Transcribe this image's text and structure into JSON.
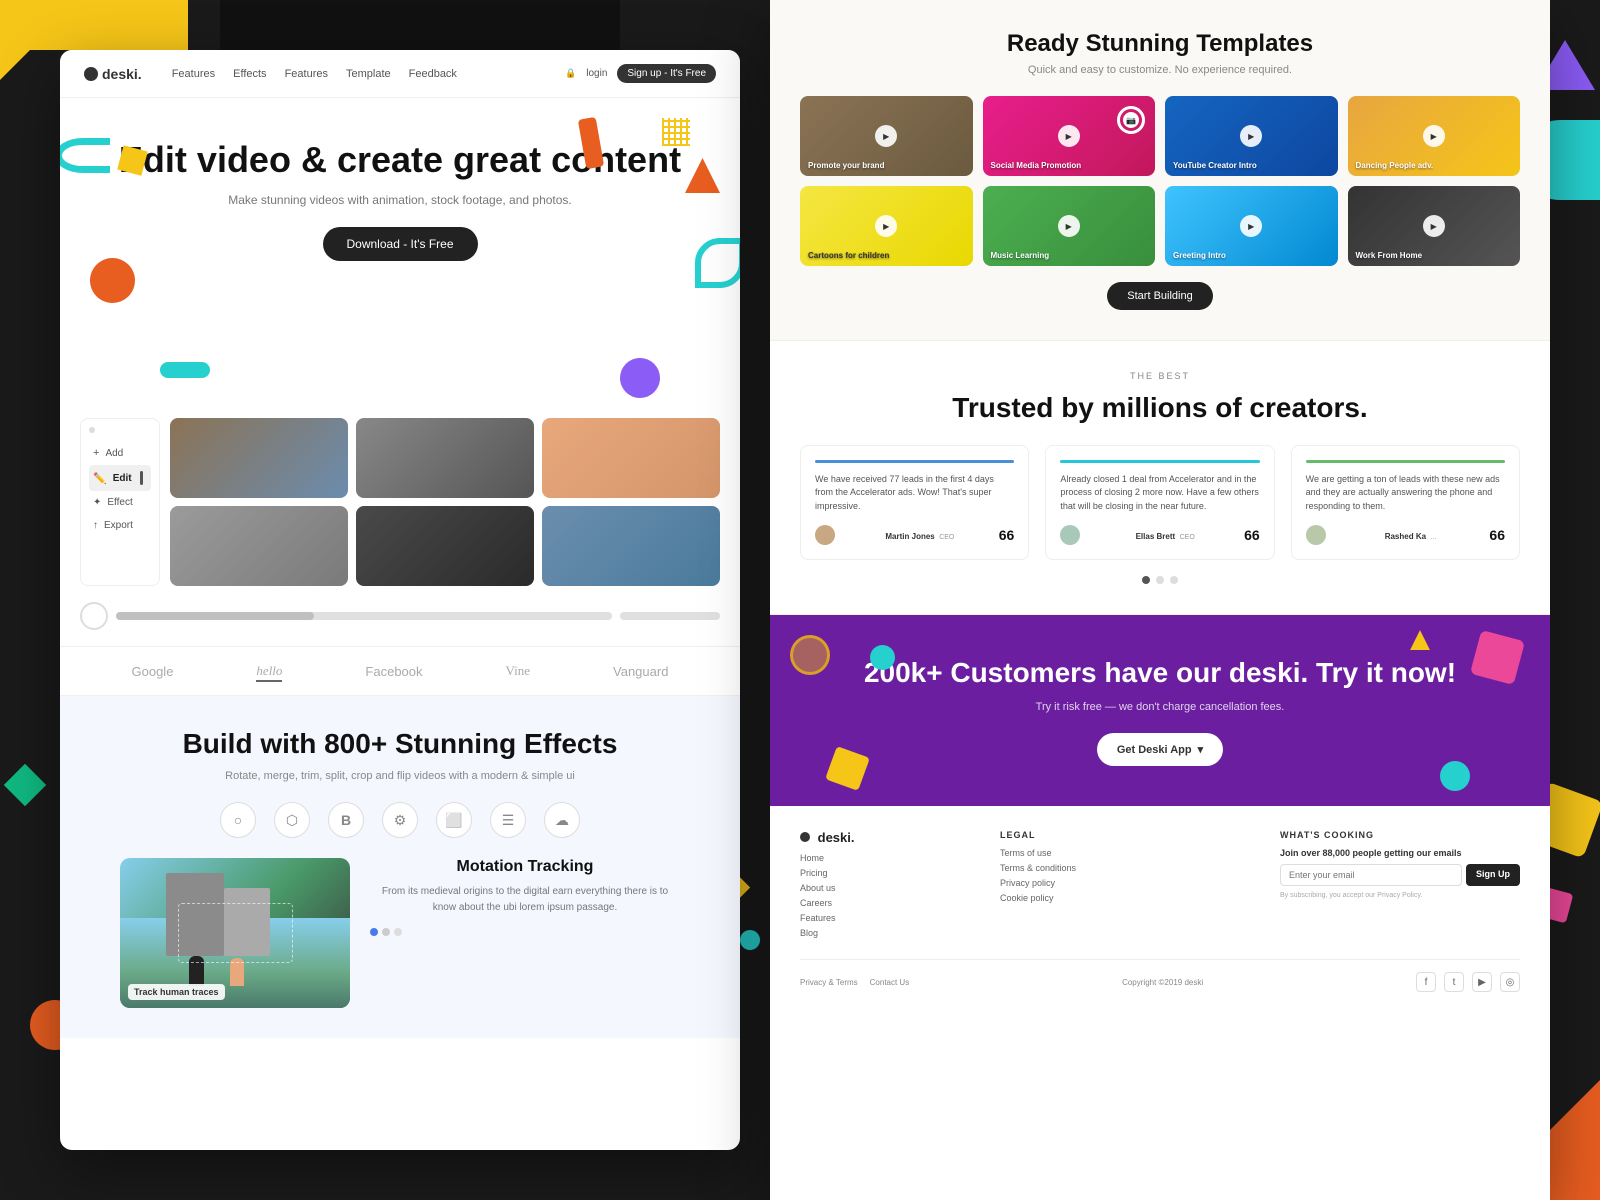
{
  "background": {
    "color": "#1a1a1a"
  },
  "left_panel": {
    "nav": {
      "logo": "deski.",
      "links": [
        "Features",
        "Effects",
        "Features",
        "Template",
        "Feedback"
      ],
      "login": "login",
      "signup": "Sign up - It's Free"
    },
    "hero": {
      "title": "Edit video & create great content",
      "subtitle": "Make stunning videos with animation, stock footage, and photos.",
      "cta_button": "Download - It's Free"
    },
    "editor": {
      "sidebar_items": [
        {
          "label": "Add",
          "active": false
        },
        {
          "label": "Edit",
          "active": true
        },
        {
          "label": "Effect",
          "active": false
        },
        {
          "label": "Export",
          "active": false
        }
      ]
    },
    "brands": [
      "Google",
      "hello",
      "Facebook",
      "Vine",
      "Vanguard"
    ],
    "effects": {
      "title": "Build with 800+ Stunning Effects",
      "subtitle": "Rotate, merge, trim, split, crop and flip videos with a modern & simple ui"
    },
    "motion": {
      "title": "Motation Tracking",
      "description": "From its medieval origins to the digital earn everything there is to know about the ubi lorem ipsum passage.",
      "image_label": "Track human traces"
    }
  },
  "right_panel": {
    "templates": {
      "title": "Ready Stunning Templates",
      "subtitle": "Quick and easy to customize. No experience required.",
      "button": "Start Building",
      "cards": [
        {
          "label": "Promote your brand",
          "color": "tc-1"
        },
        {
          "label": "Social Media Promotion",
          "color": "tc-2"
        },
        {
          "label": "YouTube Creator Intro",
          "color": "tc-3"
        },
        {
          "label": "Dancing People adv.",
          "color": "tc-4"
        },
        {
          "label": "Cartoons for children",
          "color": "tc-5"
        },
        {
          "label": "Music Learning",
          "color": "tc-6"
        },
        {
          "label": "Greeting Intro",
          "color": "tc-7"
        },
        {
          "label": "Work From Home",
          "color": "tc-8"
        }
      ]
    },
    "trusted": {
      "tag": "THE BEST",
      "title": "Trusted by millions of creators.",
      "testimonials": [
        {
          "text": "We have received 77 leads in the first 4 days from the Accelerator ads. Wow! That's super impressive.",
          "name": "Martin Jones",
          "name_suffix": "CEO",
          "score": "66",
          "bar_class": "test-bar-blue"
        },
        {
          "text": "Already closed 1 deal from Accelerator and in the process of closing 2 more now. Have a few others that will be closing in the near future.",
          "name": "Ellas Brett",
          "name_suffix": "CEO",
          "score": "66",
          "bar_class": "test-bar-teal"
        },
        {
          "text": "We are getting a ton of leads with these new ads and they are actually answering the phone and responding to them.",
          "name": "Rashed Ka",
          "name_suffix": "...",
          "score": "66",
          "bar_class": "test-bar-green"
        }
      ]
    },
    "cta": {
      "title": "200k+ Customers have our deski. Try it now!",
      "subtitle": "Try it risk free — we don't charge cancellation fees.",
      "button": "Get Deski App"
    },
    "footer": {
      "logo": "deski.",
      "info_links": [
        "Home",
        "Pricing",
        "About us",
        "Careers",
        "Features",
        "Blog"
      ],
      "legal_col_title": "Legal",
      "legal_links": [
        "Terms of use",
        "Terms & conditions",
        "Privacy policy",
        "Cookie policy"
      ],
      "newsletter_col_title": "What's Cooking",
      "newsletter_title": "Join over 88,000 people getting our emails",
      "newsletter_placeholder": "Enter your email",
      "newsletter_btn": "Sign Up",
      "newsletter_disclaimer": "By subscribing, you accept our Privacy Policy.",
      "bottom_links": [
        "Privacy & Terms",
        "Contact Us"
      ],
      "copyright": "Copyright ©2019 deski",
      "social_icons": [
        "fb",
        "tw",
        "yt",
        "ig"
      ]
    }
  }
}
